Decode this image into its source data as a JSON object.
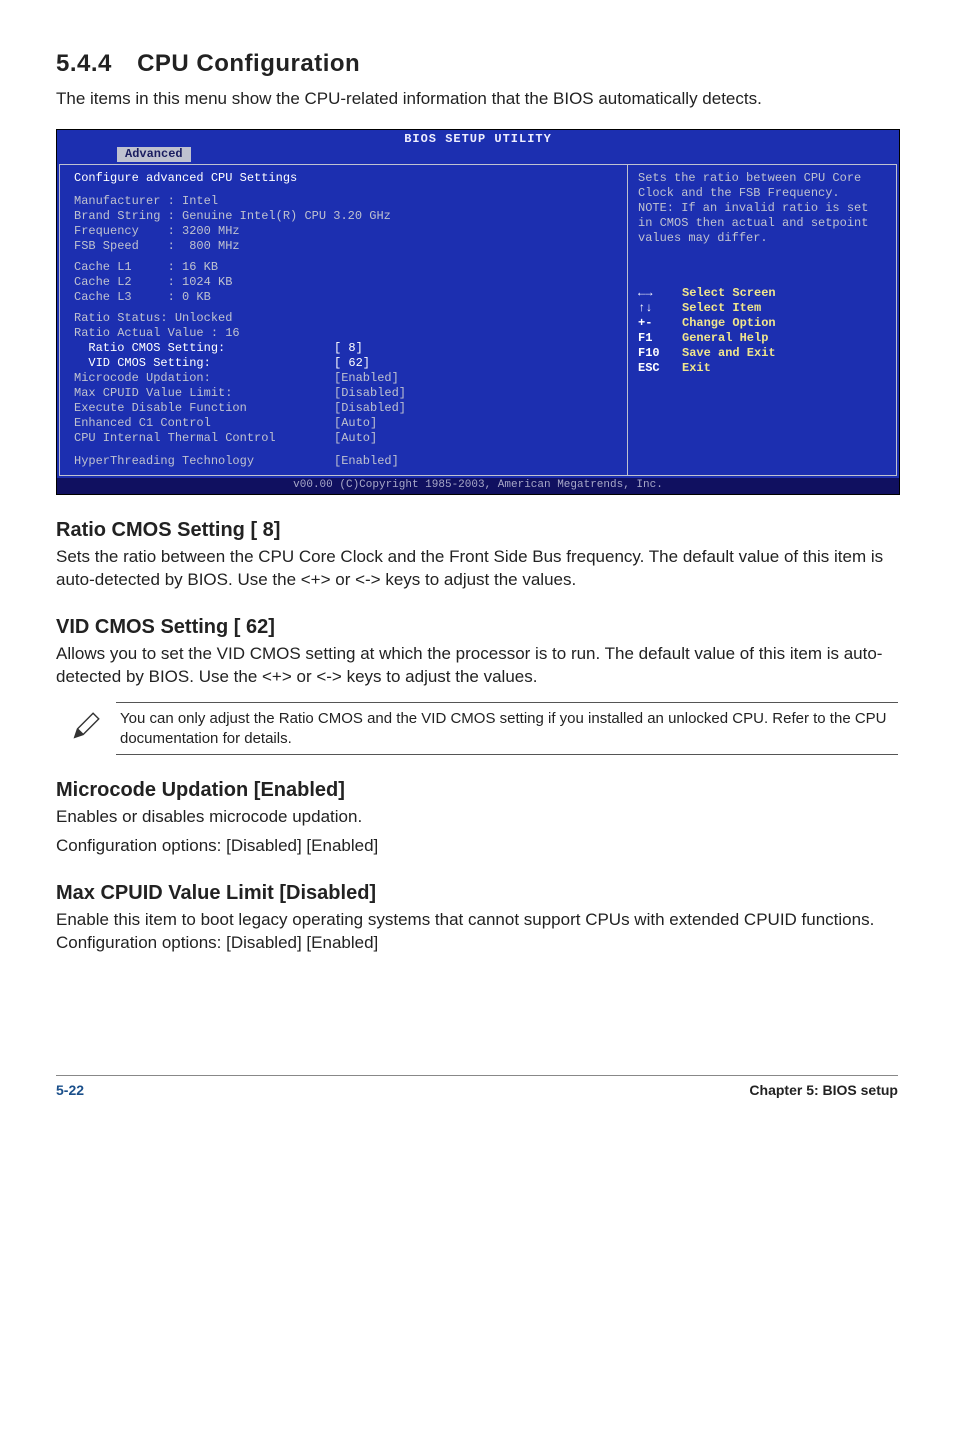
{
  "section": {
    "number": "5.4.4",
    "title": "CPU Configuration",
    "intro": "The items in this menu show the CPU-related information that the BIOS automatically detects."
  },
  "bios": {
    "title": "BIOS SETUP UTILITY",
    "tab": "Advanced",
    "left": {
      "heading": "Configure advanced CPU Settings",
      "info_rows": [
        "Manufacturer : Intel",
        "Brand String : Genuine Intel(R) CPU 3.20 GHz",
        "Frequency    : 3200 MHz",
        "FSB Speed    :  800 MHz",
        "Cache L1     : 16 KB",
        "Cache L2     : 1024 KB",
        "Cache L3     : 0 KB"
      ],
      "status_rows": [
        "Ratio Status: Unlocked",
        "Ratio Actual Value : 16"
      ],
      "settings": [
        {
          "label": "  Ratio CMOS Setting:",
          "value": "[ 8]"
        },
        {
          "label": "  VID CMOS Setting:",
          "value": "[ 62]"
        },
        {
          "label": "Microcode Updation:",
          "value": "[Enabled]"
        },
        {
          "label": "Max CPUID Value Limit:",
          "value": "[Disabled]"
        },
        {
          "label": "Execute Disable Function",
          "value": "[Disabled]"
        },
        {
          "label": "Enhanced C1 Control",
          "value": "[Auto]"
        },
        {
          "label": "CPU Internal Thermal Control",
          "value": "[Auto]"
        }
      ],
      "last_setting": {
        "label": "HyperThreading Technology",
        "value": "[Enabled]"
      }
    },
    "right": {
      "help": "Sets the ratio between CPU Core Clock and the FSB Frequency.\nNOTE: If an invalid ratio is set in CMOS then actual and setpoint values may differ.",
      "nav": [
        {
          "keys": "←→",
          "desc": "Select Screen"
        },
        {
          "keys": "↑↓",
          "desc": "Select Item"
        },
        {
          "keys": "+-",
          "desc": "Change Option"
        },
        {
          "keys": "F1",
          "desc": "General Help"
        },
        {
          "keys": "F10",
          "desc": "Save and Exit"
        },
        {
          "keys": "ESC",
          "desc": "Exit"
        }
      ]
    },
    "footer": "v00.00 (C)Copyright 1985-2003, American Megatrends, Inc."
  },
  "subsections": {
    "ratio": {
      "title": "Ratio CMOS Setting [ 8]",
      "body": "Sets the ratio between the CPU Core Clock and the Front Side Bus frequency. The default value of this item is auto-detected by BIOS. Use the <+> or <-> keys to adjust the values."
    },
    "vid": {
      "title": "VID CMOS Setting [ 62]",
      "body": "Allows you to set the VID CMOS setting at which the processor is to run. The default value of this item is auto-detected by BIOS. Use the <+> or <-> keys to adjust the values."
    },
    "note": "You can only adjust the Ratio CMOS and the VID CMOS setting if you installed an unlocked CPU. Refer to the CPU documentation for details.",
    "microcode": {
      "title": "Microcode Updation [Enabled]",
      "body1": "Enables or disables microcode updation.",
      "body2": "Configuration options: [Disabled] [Enabled]"
    },
    "maxcpuid": {
      "title": "Max CPUID Value Limit [Disabled]",
      "body": "Enable this item to boot legacy operating systems that cannot support CPUs with extended CPUID functions. Configuration options: [Disabled] [Enabled]"
    }
  },
  "footer": {
    "page": "5-22",
    "chapter": "Chapter 5: BIOS setup"
  }
}
